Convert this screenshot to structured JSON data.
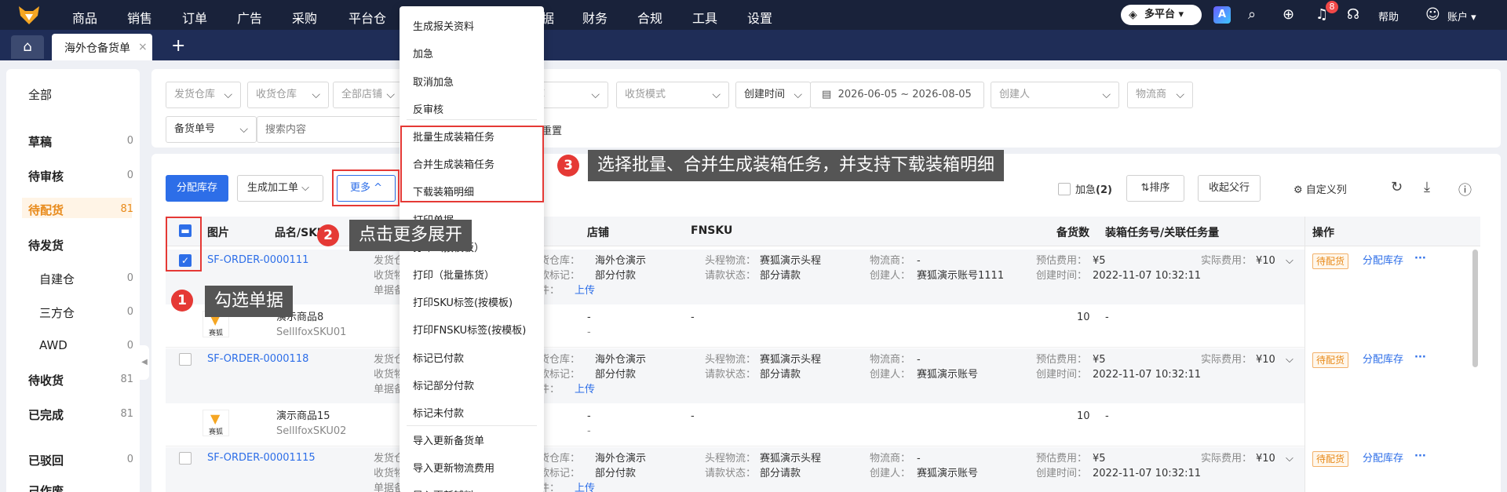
{
  "nav": {
    "items": [
      "商品",
      "销售",
      "订单",
      "广告",
      "采购",
      "平台仓",
      "据",
      "财务",
      "合规",
      "工具",
      "设置"
    ],
    "platform": "多平台",
    "badge": "8",
    "help": "帮助",
    "account": "账户"
  },
  "tabs": {
    "active": "海外仓备货单",
    "close": "×",
    "add": "+"
  },
  "sidebar": [
    {
      "label": "全部",
      "count": ""
    },
    {
      "label": "草稿",
      "count": "0"
    },
    {
      "label": "待审核",
      "count": "0"
    },
    {
      "label": "待配货",
      "count": "81"
    },
    {
      "label": "待发货",
      "count": ""
    },
    {
      "label": "自建仓",
      "count": "0"
    },
    {
      "label": "三方仓",
      "count": "0"
    },
    {
      "label": "AWD",
      "count": "0"
    },
    {
      "label": "待收货",
      "count": "81"
    },
    {
      "label": "已完成",
      "count": "81"
    },
    {
      "label": "已驳回",
      "count": "0"
    },
    {
      "label": "己作废",
      "count": ""
    }
  ],
  "filters": {
    "ship_wh": "发货仓库",
    "recv_wh": "收货仓库",
    "all_store": "全部店铺",
    "hidden_sel": "库",
    "recv_mode": "收货模式",
    "time_type": "创建时间",
    "date_range": "2026-06-05 ~ 2026-08-05",
    "creator": "创建人",
    "logistics": "物流商",
    "order_no": "备货单号",
    "search_placeholder": "搜索内容",
    "reset": "重置"
  },
  "toolbar": {
    "allocate": "分配库存",
    "gen_process": "生成加工单",
    "more": "更多",
    "urgent": "加急",
    "urgent_count": "(2)",
    "sort": "排序",
    "collapse": "收起父行",
    "custom_cols": "自定义列"
  },
  "table": {
    "headers": {
      "img": "图片",
      "name": "品名/SKU",
      "store": "店铺",
      "fnsku": "FNSKU",
      "qty": "备货数",
      "task": "装箱任务号/关联任务量",
      "ops": "操作"
    }
  },
  "orders": [
    {
      "id": "SF-ORDER-0000111",
      "ship_label": "发货仓",
      "recv_label": "收货物",
      "sheet_label": "单据备",
      "recv_wh_label": "收货仓库：",
      "recv_wh": "海外仓演示",
      "pay_label": "付款标记：",
      "pay": "部分付款",
      "attach_label": "附件：",
      "attach": "上传",
      "head_label": "头程物流：",
      "head": "赛狐演示头程",
      "req_label": "请款状态：",
      "req": "部分请款",
      "lp_label": "物流商：",
      "lp": "-",
      "creator_label": "创建人：",
      "creator": "赛狐演示账号1111",
      "est_label": "预估费用：",
      "est": "¥5",
      "actual_label": "实际费用：",
      "actual": "¥10",
      "ctime_label": "创建时间：",
      "ctime": "2022-11-07 10:32:11",
      "status": "待配货",
      "op": "分配库存",
      "more": "···"
    },
    {
      "id": "SF-ORDER-0000118",
      "ship_label": "发货仓",
      "recv_label": "收货物",
      "sheet_label": "单据备",
      "recv_wh_label": "收货仓库：",
      "recv_wh": "海外仓演示",
      "pay_label": "付款标记：",
      "pay": "部分付款",
      "attach_label": "附件：",
      "attach": "上传",
      "head_label": "头程物流：",
      "head": "赛狐演示头程",
      "req_label": "请款状态：",
      "req": "部分请款",
      "lp_label": "物流商：",
      "lp": "-",
      "creator_label": "创建人：",
      "creator": "赛狐演示账号",
      "est_label": "预估费用：",
      "est": "¥5",
      "actual_label": "实际费用：",
      "actual": "¥10",
      "ctime_label": "创建时间：",
      "ctime": "2022-11-07 10:32:11",
      "status": "待配货",
      "op": "分配库存",
      "more": "···"
    },
    {
      "id": "SF-ORDER-00001115",
      "ship_label": "发货仓",
      "recv_label": "收货物",
      "sheet_label": "单据备",
      "recv_wh_label": "收货仓库：",
      "recv_wh": "海外仓演示",
      "pay_label": "付款标记：",
      "pay": "部分付款",
      "attach_label": "附件：",
      "attach": "上传",
      "head_label": "头程物流：",
      "head": "赛狐演示头程",
      "req_label": "请款状态：",
      "req": "部分请款",
      "lp_label": "物流商：",
      "lp": "-",
      "creator_label": "创建人：",
      "creator": "赛狐演示账号",
      "est_label": "预估费用：",
      "est": "¥5",
      "actual_label": "实际费用：",
      "actual": "¥10",
      "ctime_label": "创建时间：",
      "ctime": "2022-11-07 10:32:11",
      "status": "待配货",
      "op": "分配库存",
      "more": "···"
    }
  ],
  "products": [
    {
      "name": "演示商品8",
      "sku": "SelllfoxSKU01",
      "logo_text": "赛狐",
      "store": "-",
      "store2": "-",
      "fnsku": "-",
      "qty": "10",
      "task": "-"
    },
    {
      "name": "演示商品15",
      "sku": "SelllfoxSKU02",
      "logo_text": "赛狐",
      "store": "-",
      "store2": "-",
      "fnsku": "-",
      "qty": "10",
      "task": "-"
    }
  ],
  "menu": [
    "生成报关资料",
    "加急",
    "取消加急",
    "反审核",
    "批量生成装箱任务",
    "合并生成装箱任务",
    "下载装箱明细",
    "打印单据",
    "打印（按模板）",
    "打印（批量拣货）",
    "打印SKU标签(按模板)",
    "打印FNSKU标签(按模板)",
    "标记已付款",
    "标记部分付款",
    "标记未付款",
    "导入更新备货单",
    "导入更新物流费用",
    "导入更新辅料"
  ],
  "callouts": [
    {
      "num": "1",
      "text": "勾选单据"
    },
    {
      "num": "2",
      "text": "点击更多展开"
    },
    {
      "num": "3",
      "text": "选择批量、合并生成装箱任务，并支持下载装箱明细"
    }
  ],
  "colors": {
    "primary": "#2d6ee8",
    "nav": "#19223a",
    "accent": "#e53935",
    "status": "#e88a1a"
  }
}
